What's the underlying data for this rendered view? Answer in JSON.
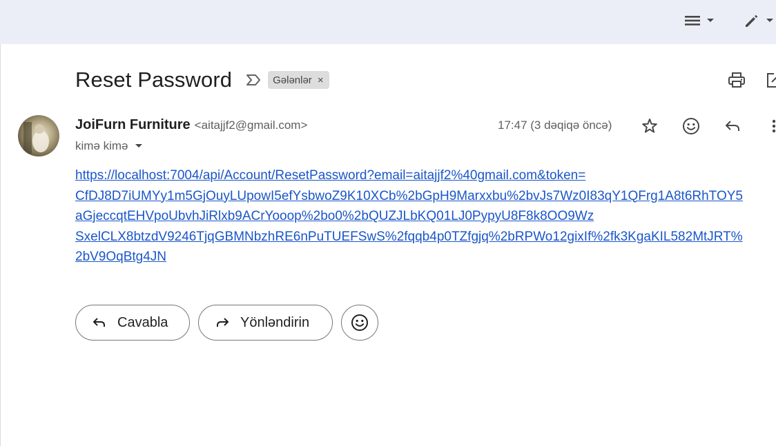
{
  "topbar": {
    "density_icon": "view-list-icon",
    "compose_icon": "pencil-icon"
  },
  "email": {
    "subject": "Reset Password",
    "label": "Gələnlər",
    "label_remove": "×",
    "sender_name": "JoiFurn Furniture",
    "sender_email": "<aitajjf2@gmail.com>",
    "to_text": "kimə kimə",
    "timestamp": "17:47 (3 dəqiqə öncə)",
    "link_lines": [
      "https://localhost:7004/api/Account/ResetPassword?email=aitajjf2%40gmail.com&token=",
      "CfDJ8D7iUMYy1m5GjOuyLUpowI5efYsbwoZ9K10XCb%2bGpH9Marxxbu%2bvJs7Wz0I83qY1QFrg1A8t6RhTOY5",
      "aGjeccqtEHVpoUbvhJiRlxb9ACrYooop%2bo0%2bQUZJLbKQ01LJ0PypyU8F8k8OO9Wz",
      "SxelCLX8btzdV9246TjqGBMNbzhRE6nPuTUEFSwS%2fqqb4p0TZfgjq%2bRPWo12gixIf%2fk3KgaKIL582MtJRT%",
      "2bV9OqBtg4JN"
    ]
  },
  "actions": {
    "reply_label": "Cavabla",
    "forward_label": "Yönləndirin"
  },
  "colors": {
    "topbar_bg": "#eceef7",
    "link": "#1a56c9",
    "chip_bg": "#dddddd"
  }
}
